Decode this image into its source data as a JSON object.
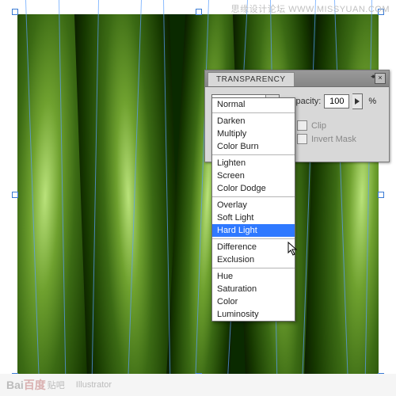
{
  "watermark": {
    "top": "思缘设计论坛  WWW.MISSYUAN.COM"
  },
  "footer": {
    "baidu_a": "Bai",
    "baidu_b": "百度",
    "baidu_sub": "贴吧",
    "app": "Illustrator"
  },
  "panel": {
    "title": "TRANSPARENCY",
    "close": "×",
    "blend_selected": "Normal",
    "opacity_label": "Opacity:",
    "opacity_value": "100",
    "percent": "%",
    "clip_label": "Clip",
    "invert_label": "Invert Mask"
  },
  "blend_modes": {
    "normal": "Normal",
    "darken": "Darken",
    "multiply": "Multiply",
    "colorburn": "Color Burn",
    "lighten": "Lighten",
    "screen": "Screen",
    "colordodge": "Color Dodge",
    "overlay": "Overlay",
    "softlight": "Soft Light",
    "hardlight": "Hard Light",
    "difference": "Difference",
    "exclusion": "Exclusion",
    "hue": "Hue",
    "saturation": "Saturation",
    "color": "Color",
    "luminosity": "Luminosity"
  }
}
